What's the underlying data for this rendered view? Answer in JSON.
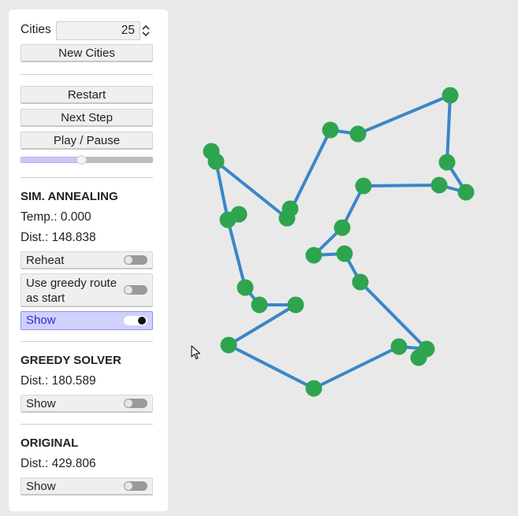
{
  "controls": {
    "cities_label": "Cities",
    "cities_value": "25",
    "new_cities": "New Cities",
    "restart": "Restart",
    "next_step": "Next Step",
    "play_pause": "Play / Pause",
    "speed_level": 0.46
  },
  "annealing": {
    "title": "SIM. ANNEALING",
    "temp": "Temp.: 0.000",
    "dist": "Dist.: 148.838",
    "reheat": {
      "label": "Reheat",
      "on": false
    },
    "greedy_start_line1": "Use greedy route",
    "greedy_start_line2": "as start",
    "greedy_start_on": false,
    "show": {
      "label": "Show",
      "on": true
    }
  },
  "greedy": {
    "title": "GREEDY SOLVER",
    "dist": "Dist.: 180.589",
    "show": {
      "label": "Show",
      "on": false
    }
  },
  "original": {
    "title": "ORIGINAL",
    "dist": "Dist.: 429.806",
    "show": {
      "label": "Show",
      "on": false
    }
  },
  "colors": {
    "route": "#3a86c8",
    "city": "#2ea44f",
    "background": "#e9e9e9"
  },
  "icons": {
    "spinner": "up-down-arrows-icon",
    "cursor": "mouse-pointer-icon"
  }
}
